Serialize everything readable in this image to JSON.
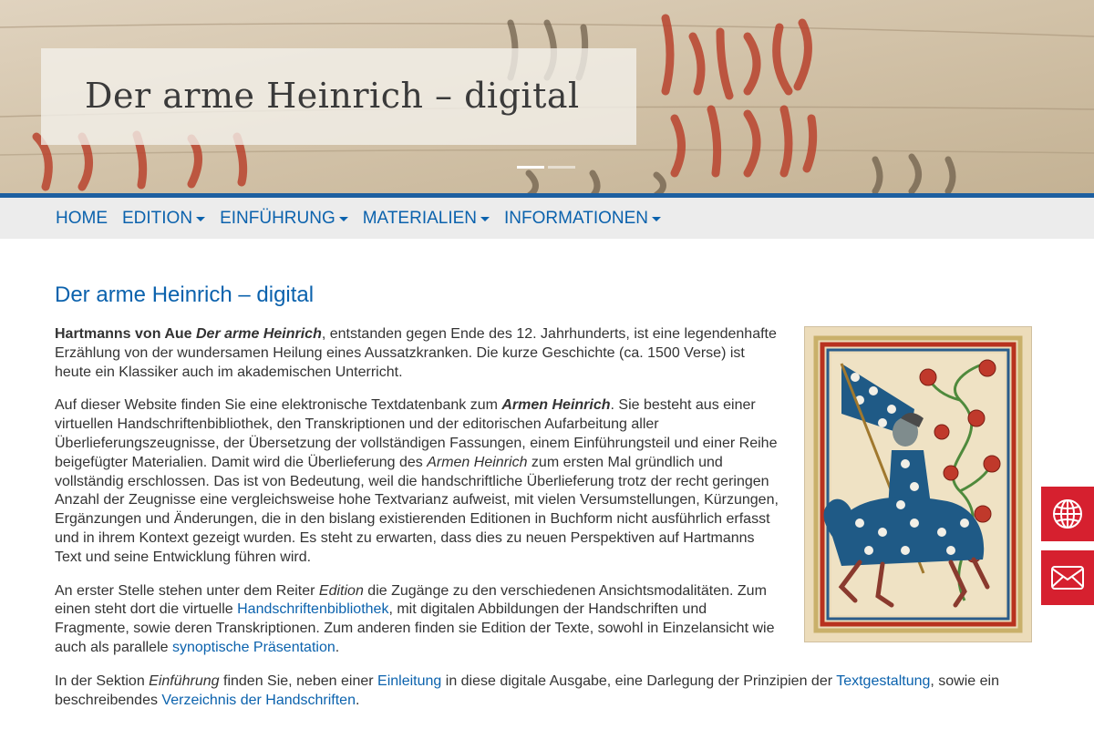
{
  "banner": {
    "title": "Der arme Heinrich – digital"
  },
  "nav": {
    "items": [
      {
        "label": "HOME",
        "dropdown": false
      },
      {
        "label": "EDITION",
        "dropdown": true
      },
      {
        "label": "EINFÜHRUNG",
        "dropdown": true
      },
      {
        "label": "MATERIALIEN",
        "dropdown": true
      },
      {
        "label": "INFORMATIONEN",
        "dropdown": true
      }
    ]
  },
  "main": {
    "heading": "Der arme Heinrich – digital",
    "p1": {
      "author": "Hartmanns von Aue",
      "work": "Der arme Heinrich",
      "rest": ", entstanden gegen Ende des 12. Jahrhunderts, ist eine legendenhafte Erzählung von der wundersamen Heilung eines Aussatzkranken. Die kurze Geschichte (ca. 1500 Verse) ist heute ein Klassiker auch im akademischen Unterricht."
    },
    "p2": {
      "a": "Auf dieser Website finden Sie eine elektronische Textdatenbank zum ",
      "b": "Armen Heinrich",
      "c": ". Sie besteht aus einer virtuellen Handschriftenbibliothek, den Transkriptionen und der editorischen Aufarbeitung aller Überlieferungszeugnisse, der Übersetzung der vollständigen Fassungen, einem Einführungsteil und einer Reihe beigefügter Materialien. Damit wird die Überlieferung des ",
      "d": "Armen Heinrich",
      "e": " zum ersten Mal gründlich und vollständig erschlossen. Das ist von Bedeutung, weil die handschriftliche Überlieferung trotz der recht geringen Anzahl der Zeugnisse eine vergleichsweise hohe Textvarianz aufweist, mit vielen Versumstellungen, Kürzungen, Ergänzungen und Änderungen, die in den bislang existierenden Editionen in Buchform nicht ausführlich erfasst und in ihrem Kontext gezeigt wurden. Es steht zu erwarten, dass dies zu neuen Perspektiven auf Hartmanns Text und seine Entwicklung führen wird."
    },
    "p3": {
      "a": "An erster Stelle stehen unter dem Reiter ",
      "b": "Edition",
      "c": " die Zugänge zu den verschiedenen Ansichtsmodalitäten. Zum einen steht dort die virtuelle ",
      "link1": "Handschriftenbibliothek",
      "d": ", mit digitalen Abbildungen der Handschriften und Fragmente, sowie deren Transkriptionen. Zum anderen finden sie Edition der Texte, sowohl in Einzelansicht wie auch als parallele ",
      "link2": "synoptische Präsentation",
      "e": "."
    },
    "p4": {
      "a": "In der Sektion ",
      "b": "Einführung",
      "c": " finden Sie, neben einer ",
      "link1": "Einleitung",
      "d": " in diese digitale Ausgabe, eine Darlegung der Prinzipien der ",
      "link2": "Textgestaltung",
      "e": ", sowie ein beschreibendes ",
      "link3": "Verzeichnis der Handschriften",
      "f": "."
    }
  },
  "side": {
    "language_icon": "globe-icon",
    "contact_icon": "envelope-icon"
  },
  "colors": {
    "brand_blue": "#0b62ad",
    "nav_line": "#1d5fa0",
    "side_red": "#d6202f"
  }
}
